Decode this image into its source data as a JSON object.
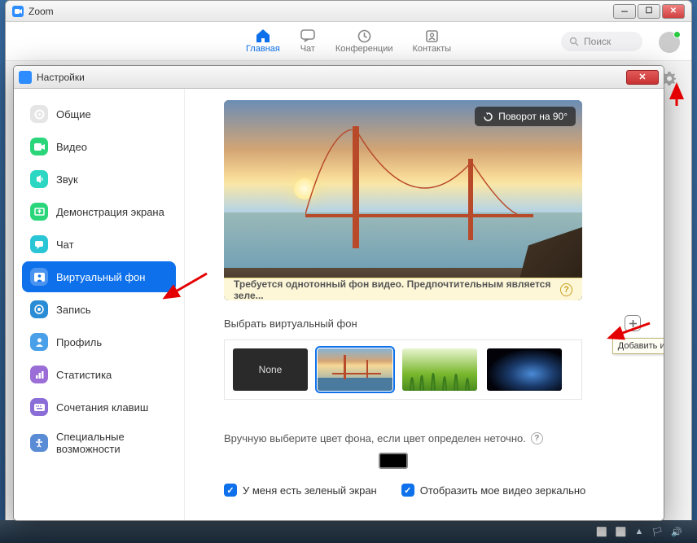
{
  "window": {
    "title": "Zoom"
  },
  "nav": {
    "tabs": [
      {
        "label": "Главная"
      },
      {
        "label": "Чат"
      },
      {
        "label": "Конференции"
      },
      {
        "label": "Контакты"
      }
    ],
    "search_placeholder": "Поиск"
  },
  "settings": {
    "title": "Настройки",
    "sidebar": [
      {
        "label": "Общие",
        "color": "#dcdcdc"
      },
      {
        "label": "Видео",
        "color": "#2bd67b"
      },
      {
        "label": "Звук",
        "color": "#2bd6c2"
      },
      {
        "label": "Демонстрация экрана",
        "color": "#2bd67b"
      },
      {
        "label": "Чат",
        "color": "#2bc6d6"
      },
      {
        "label": "Виртуальный фон",
        "color": "#fff"
      },
      {
        "label": "Запись",
        "color": "#2b8cd6"
      },
      {
        "label": "Профиль",
        "color": "#4aa0e8"
      },
      {
        "label": "Статистика",
        "color": "#9b6dd6"
      },
      {
        "label": "Сочетания клавиш",
        "color": "#8a6dd6"
      },
      {
        "label": "Специальные возможности",
        "color": "#5a8cd6"
      }
    ],
    "rotate_label": "Поворот на 90°",
    "warning": "Требуется однотонный фон видео. Предпочтительным является зеле...",
    "choose_bg_label": "Выбрать виртуальный фон",
    "add_tooltip": "Добавить изображение",
    "thumbs": {
      "none": "None"
    },
    "manual_label": "Вручную выберите цвет фона, если цвет определен неточно.",
    "check_green": "У меня есть зеленый экран",
    "check_mirror": "Отобразить мое видео зеркально"
  }
}
